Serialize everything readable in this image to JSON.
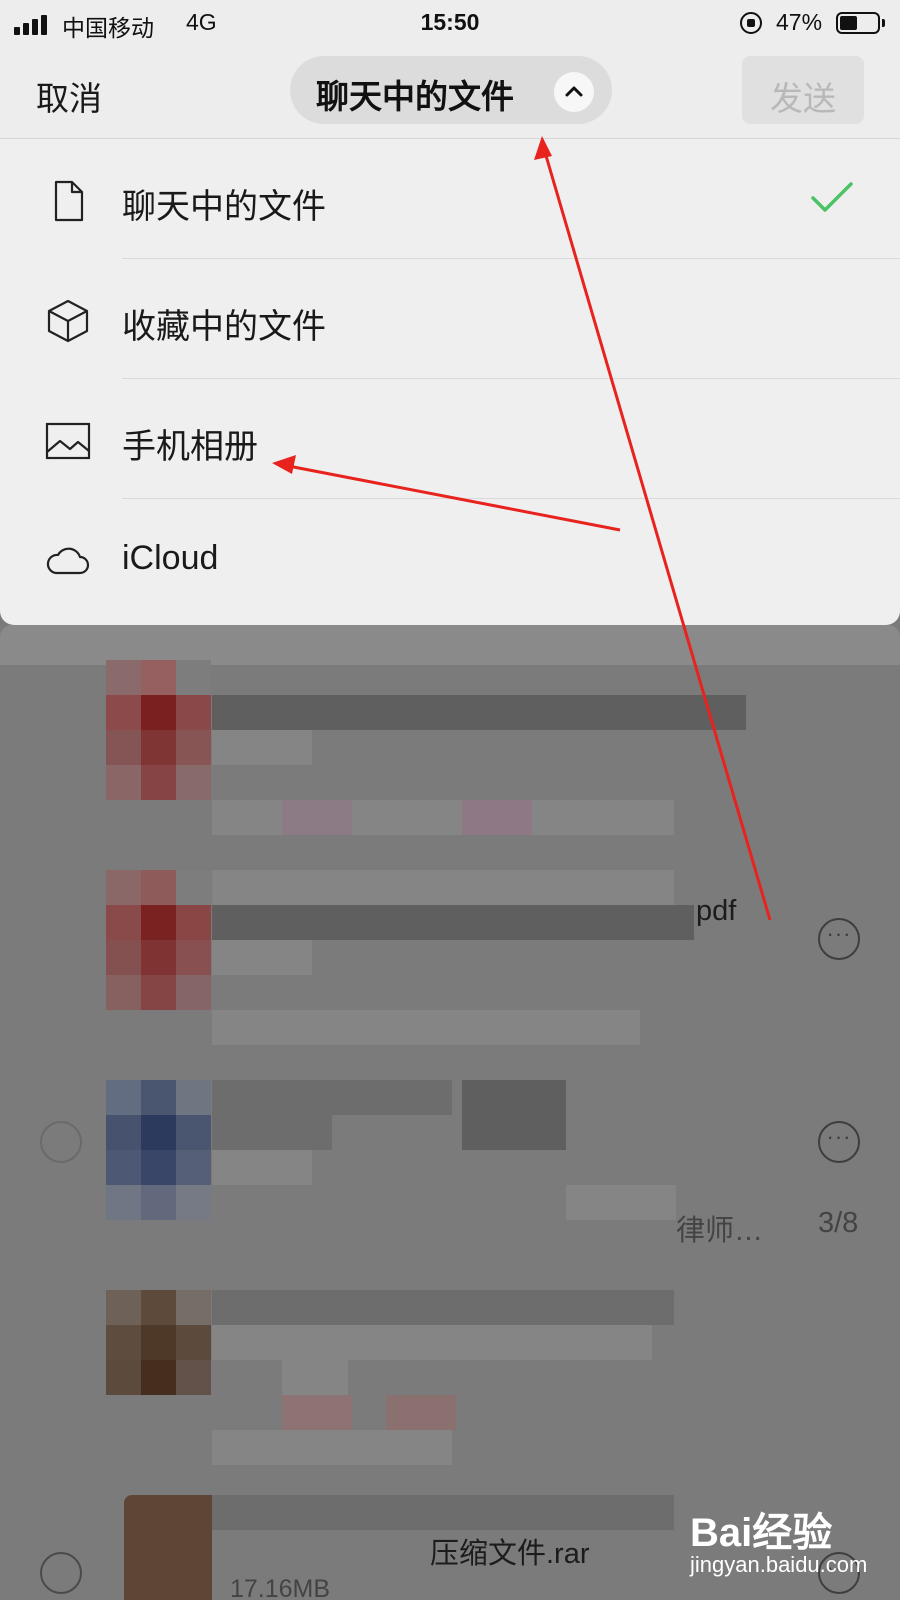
{
  "status_bar": {
    "carrier": "中国移动",
    "network": "4G",
    "time": "15:50",
    "battery_percent": "47%",
    "battery_level": 0.47,
    "signal_bars": 4
  },
  "header": {
    "cancel_label": "取消",
    "title": "聊天中的文件",
    "send_label": "发送"
  },
  "menu": {
    "items": [
      {
        "label": "聊天中的文件",
        "icon": "file-icon",
        "selected": true
      },
      {
        "label": "收藏中的文件",
        "icon": "cube-icon",
        "selected": false
      },
      {
        "label": "手机相册",
        "icon": "image-icon",
        "selected": false
      },
      {
        "label": "iCloud",
        "icon": "cloud-icon",
        "selected": false
      }
    ]
  },
  "list": {
    "visible_fragments": {
      "pdf_suffix": "pdf",
      "row3_subtitle": "律师…",
      "row3_count": "3/8",
      "row5_name": "压缩文件.rar",
      "row5_size": "17.16MB"
    }
  },
  "watermark": {
    "logo": "Bai经验",
    "url": "jingyan.baidu.com"
  },
  "colors": {
    "header_bg": "#ededed",
    "menu_bg": "#efefef",
    "check_green": "#4cc266",
    "overlay_grey": "#7b7b7b",
    "arrow_red": "#e8231e"
  }
}
